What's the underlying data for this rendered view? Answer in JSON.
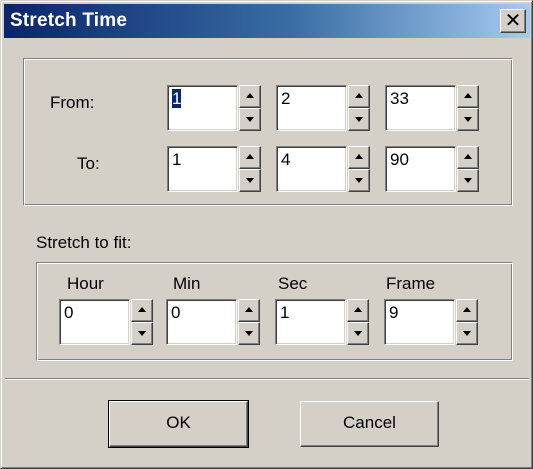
{
  "window": {
    "title": "Stretch Time",
    "close_symbol": "✕"
  },
  "from": {
    "label": "From:",
    "values": [
      "1",
      "2",
      "33"
    ]
  },
  "to": {
    "label": "To:",
    "values": [
      "1",
      "4",
      "90"
    ]
  },
  "stretch": {
    "label": "Stretch to fit:",
    "headers": [
      "Hour",
      "Min",
      "Sec",
      "Frame"
    ],
    "values": [
      "0",
      "0",
      "1",
      "9"
    ]
  },
  "buttons": {
    "ok": "OK",
    "cancel": "Cancel"
  },
  "icons": {
    "spin_up": "triangle-up",
    "spin_down": "triangle-down",
    "close": "x"
  },
  "colors": {
    "title_gradient_start": "#0a246a",
    "title_gradient_end": "#a6caf0",
    "face": "#d4d0c8",
    "selection": "#0a246a"
  }
}
